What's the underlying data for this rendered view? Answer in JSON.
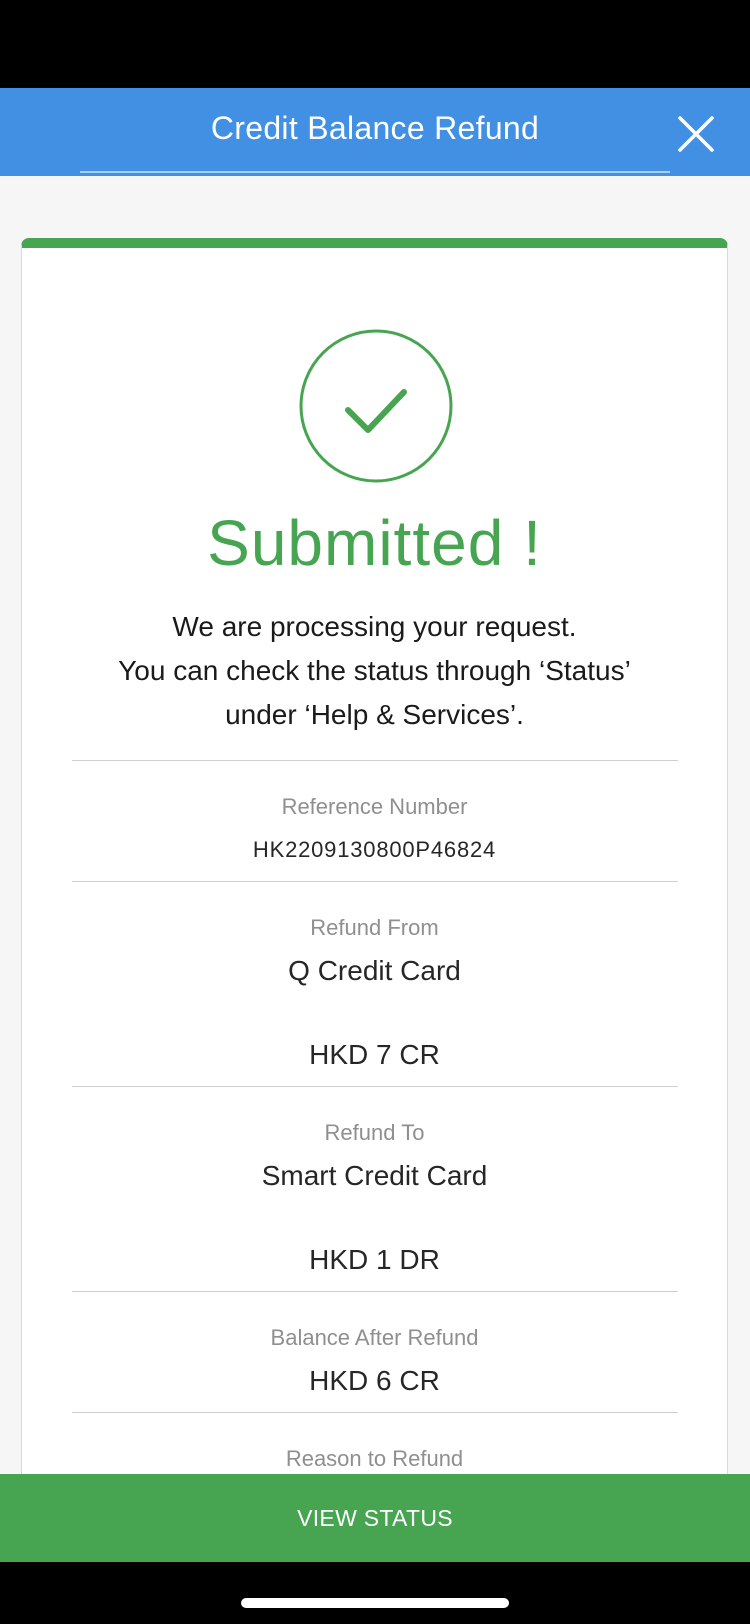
{
  "header": {
    "title": "Credit Balance Refund"
  },
  "icons": {
    "close": "close-icon",
    "success": "checkmark-circle-icon"
  },
  "colors": {
    "header_bg": "#4190e4",
    "success_green": "#47a552"
  },
  "result": {
    "title": "Submitted !",
    "message": [
      "We are processing your request.",
      "You can check the status through ‘Status’",
      "under ‘Help & Services’."
    ]
  },
  "details": {
    "reference": {
      "label": "Reference Number",
      "value": "HK2209130800P46824"
    },
    "refund_from": {
      "label": "Refund From",
      "card": "Q Credit Card",
      "amount": "HKD 7 CR"
    },
    "refund_to": {
      "label": "Refund To",
      "card": "Smart Credit Card",
      "amount": "HKD 1 DR"
    },
    "balance_after": {
      "label": "Balance After Refund",
      "amount": "HKD 6 CR"
    },
    "reason": {
      "label": "Reason to Refund"
    }
  },
  "footer": {
    "button_label": "VIEW STATUS"
  }
}
